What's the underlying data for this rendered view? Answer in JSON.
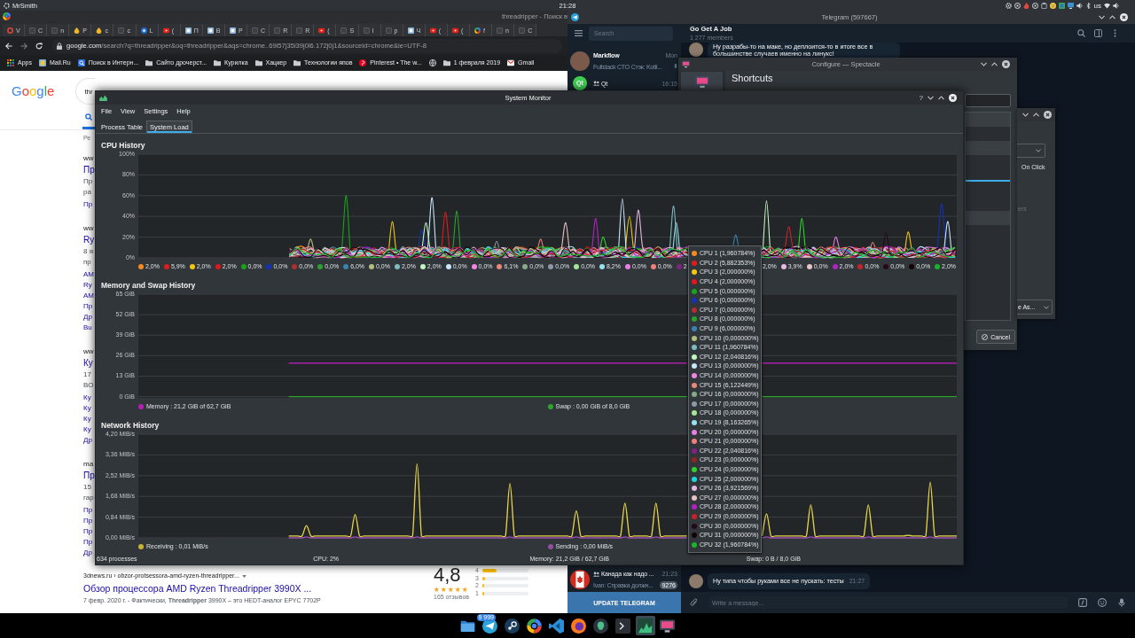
{
  "top_panel": {
    "user": "MrSmith",
    "clock": "21:28",
    "tray": [
      {
        "kind": "gear"
      },
      {
        "kind": "ring"
      },
      {
        "kind": "flame"
      },
      {
        "kind": "ring"
      },
      {
        "kind": "clipboard"
      },
      {
        "kind": "smiley"
      },
      {
        "kind": "tile"
      },
      {
        "kind": "screen"
      },
      {
        "kind": "speaker"
      },
      {
        "kind": "bluetooth"
      },
      {
        "kind": "text",
        "label": "us"
      },
      {
        "kind": "wifi"
      },
      {
        "kind": "speaker"
      }
    ]
  },
  "browser": {
    "title": "threadripper - Поиск в",
    "tabs": [
      {
        "kind": "ring",
        "label": "V"
      },
      {
        "kind": "page",
        "label": "C"
      },
      {
        "kind": "page",
        "label": "n"
      },
      {
        "kind": "drop",
        "label": "P"
      },
      {
        "kind": "drop",
        "label": "c"
      },
      {
        "kind": "page",
        "label": "c"
      },
      {
        "kind": "circle",
        "label": "L"
      },
      {
        "kind": "play",
        "label": "("
      },
      {
        "kind": "square",
        "label": "П"
      },
      {
        "kind": "square",
        "label": "В"
      },
      {
        "kind": "square",
        "label": "Р"
      },
      {
        "kind": "page",
        "label": "C"
      },
      {
        "kind": "page",
        "label": "R"
      },
      {
        "kind": "page",
        "label": "R"
      },
      {
        "kind": "play",
        "label": "("
      },
      {
        "kind": "page",
        "label": "S"
      },
      {
        "kind": "page",
        "label": "I"
      },
      {
        "kind": "page",
        "label": "p"
      },
      {
        "kind": "square",
        "label": "Ч"
      },
      {
        "kind": "play",
        "label": "("
      },
      {
        "kind": "play",
        "label": "("
      },
      {
        "kind": "google",
        "label": "f"
      },
      {
        "kind": "page",
        "label": "n"
      },
      {
        "kind": "page",
        "label": "C"
      }
    ],
    "address": {
      "host": "google.com",
      "path": "/search?q=threadripper&oq=threadripper&aqs=chrome..69i57j35i39j0l6.172j0j1&sourceid=chrome&ie=UTF-8"
    },
    "bookmarks": [
      {
        "kind": "grid",
        "label": "Apps"
      },
      {
        "kind": "square",
        "label": "Mail.Ru"
      },
      {
        "kind": "magnifier",
        "label": "Поиск в Интерн..."
      },
      {
        "kind": "folder",
        "label": "Сайто дрочерст..."
      },
      {
        "kind": "folder",
        "label": "Курилка"
      },
      {
        "kind": "folder",
        "label": "Хацкер"
      },
      {
        "kind": "folder",
        "label": "Технологии япов"
      },
      {
        "kind": "circle",
        "label": "Pinterest • The w..."
      },
      {
        "kind": "globe"
      },
      {
        "kind": "folder",
        "label": "1 февраля 2019"
      },
      {
        "kind": "envelope",
        "label": "Gmail"
      }
    ],
    "page": {
      "logo": "Google",
      "query": "thr",
      "result_count": "Ре",
      "results": [
        {
          "crumb": "ww",
          "title": "Пр",
          "snippet": [
            "Пр",
            "ра"
          ],
          "links": [
            "Пр"
          ]
        },
        {
          "crumb": "ww",
          "title": "Ry",
          "snippet": [
            "8 я",
            "пр"
          ],
          "links": [
            "AM",
            "Ry",
            "AM",
            "Пр",
            "Др",
            "Bu"
          ]
        },
        {
          "crumb": "ww",
          "title": "Ку",
          "snippet": [
            "17",
            "BO"
          ],
          "links": [
            "Ку",
            "Ку",
            "Ку",
            "Ку",
            "Др"
          ]
        },
        {
          "crumb": "ma",
          "title": "Пр",
          "snippet": [
            "15",
            "гар"
          ],
          "links": [
            "Пр",
            "Пр",
            "Пр",
            "Пр",
            "Др"
          ]
        }
      ],
      "featured": {
        "url": "3dnews.ru › obzor-protsessora-amd-ryzen-threadripper...",
        "title": "Обзор процессора AMD Ryzen Threadripper 3990X ...",
        "snippet": "7 февр. 2020 г. - Фактически, **Threadripper** 3990X – это HEDT-аналог EPYC 7702P"
      },
      "rating": {
        "score": "4,8",
        "stars": 5,
        "reviews": "165 отзывов",
        "bars": [
          {
            "label": "4",
            "level": 0.3
          },
          {
            "label": "3",
            "level": 0.06
          },
          {
            "label": "2",
            "level": 0.03
          },
          {
            "label": "1",
            "level": 0.04
          }
        ]
      }
    }
  },
  "telegram": {
    "title": "Telegram (597667)",
    "search": {
      "placeholder": "Search"
    },
    "chats_top": [
      {
        "kind": "photo",
        "name": "Markflow",
        "time": "Mon",
        "preview": "Fullstack CTO Стэк: Kotli...",
        "pinned": true,
        "group": false
      },
      {
        "kind": "logo",
        "avatar_text": "Qt",
        "name": "Qt",
        "time": "16:15",
        "pinned": false,
        "group": true
      }
    ],
    "chats_bottom": [
      {
        "kind": "flag",
        "name": "Канада как надо ...",
        "time": "21:23",
        "preview": "Ivan: Справка должн...",
        "badge": "9276",
        "pinned": false,
        "group": true
      }
    ],
    "update_button": "UPDATE TELEGRAM",
    "chat": {
      "title": "Go Get A Job",
      "subtitle": "1 277 members",
      "messages_top": [
        {
          "text": "Ну разрабы-то на маке, но деплоится-то в итоге все в большинстве случаев именно на линукс!"
        }
      ],
      "messages_bottom": [
        {
          "text": "Ну типа чтобы руками все не пускать: тесты",
          "time": "21:27"
        }
      ],
      "composer": {
        "placeholder": "Write a message..."
      }
    }
  },
  "spectacle": {
    "title": "Configure — Spectacle",
    "heading": "Shortcuts",
    "cancel": "Cancel"
  },
  "settings_dialog": {
    "options": [
      {
        "label": "On Click",
        "disabled": false
      },
      {
        "label": "ers",
        "disabled": true
      }
    ],
    "dropdown": "e As..."
  },
  "system_monitor": {
    "title": "System Monitor",
    "help": "?",
    "menu": [
      "File",
      "View",
      "Settings",
      "Help"
    ],
    "tabs": [
      {
        "label": "Process Table",
        "selected": false
      },
      {
        "label": "System Load",
        "selected": true
      }
    ],
    "sections": [
      {
        "kind": "per_core",
        "title": "CPU History",
        "y_labels": [
          "100%",
          "80%",
          "60%",
          "40%",
          "20%",
          "0%"
        ],
        "legend": {
          "start": [
            {
              "color": "#f58a1f",
              "reading": "2,0%"
            },
            {
              "color": "#e31a1c",
              "reading": "5,9%"
            },
            {
              "color": "#f2c713",
              "reading": "2,0%"
            },
            {
              "color": "#e4151b",
              "reading": "2,0%"
            },
            {
              "color": "#1aa31a",
              "reading": "0,0%"
            },
            {
              "color": "#1432b8",
              "reading": "0,0%"
            },
            {
              "color": "#b22d2d",
              "reading": "0,0%"
            },
            {
              "color": "#2ca02c",
              "reading": "0,0%"
            },
            {
              "color": "#3a84b0",
              "reading": "6,0%"
            },
            {
              "color": "#b5bd7d",
              "reading": "0,0%"
            },
            {
              "color": "#7cbcc0",
              "reading": "2,0%"
            },
            {
              "color": "#c3f5c0",
              "reading": "2,0%"
            },
            {
              "color": "#c6e8fb",
              "reading": "0,0%"
            },
            {
              "color": "#f384e0",
              "reading": "0,0%"
            },
            {
              "color": "#e8877a",
              "reading": "6,1%"
            },
            {
              "color": "#8aa88a",
              "reading": "0,0%"
            },
            {
              "color": "#8c98a4",
              "reading": "0,0%"
            },
            {
              "color": "#a6e597",
              "reading": "0,0%"
            },
            {
              "color": "#98e2ef",
              "reading": "8,2%"
            },
            {
              "color": "#e87ee6",
              "reading": "0,0%"
            },
            {
              "color": "#ef7f79",
              "reading": "0,0%"
            },
            {
              "color": "#7f2386",
              "reading": "2"
            }
          ],
          "end": [
            {
              "reading": "2,0%"
            },
            {
              "color": "#e6b8e4",
              "reading": "3,9%"
            },
            {
              "color": "#e6c3c5",
              "reading": "0,0%"
            },
            {
              "color": "#b025c0",
              "reading": "2,0%"
            },
            {
              "color": "#c8222a",
              "reading": "0,0%"
            },
            {
              "color": "#25081e",
              "reading": "0,0%"
            },
            {
              "color": "#120404",
              "reading": "0,0%"
            },
            {
              "color": "#18b52a",
              "reading": "2,0%"
            }
          ]
        }
      },
      {
        "kind": "pair",
        "title": "Memory and Swap History",
        "chart_data": {
          "type": "line",
          "grid": true,
          "categories": [
            null,
            null,
            null,
            null,
            null,
            null,
            null,
            null,
            null,
            null,
            null,
            null,
            null,
            null,
            null,
            null,
            null,
            null,
            null,
            null,
            null,
            null,
            null,
            null,
            null,
            null,
            null,
            null,
            null,
            null,
            null,
            null,
            null,
            null,
            null,
            null,
            null,
            null,
            null,
            null,
            null,
            null,
            null,
            null,
            null,
            null,
            null,
            null,
            null,
            null,
            null,
            null,
            null,
            null,
            null,
            null,
            null,
            null,
            null,
            null,
            null,
            null,
            null,
            null,
            null,
            null,
            null,
            null,
            null,
            null,
            null,
            null,
            null,
            null,
            null,
            null,
            null,
            null,
            null,
            null,
            null,
            null,
            null,
            null,
            null,
            null,
            null,
            null,
            null,
            null,
            null,
            null,
            null,
            null,
            null,
            null,
            null,
            null,
            null,
            null,
            null,
            null,
            null,
            null,
            null,
            null,
            null,
            null,
            null,
            null,
            null,
            null,
            null,
            null,
            null,
            null,
            null,
            null,
            null,
            null,
            null,
            null,
            null,
            null,
            null,
            null,
            null,
            null,
            null,
            null,
            null,
            null,
            null,
            null,
            null,
            null,
            null,
            null,
            null,
            null,
            null,
            null,
            null,
            null,
            null,
            null,
            null,
            null,
            null,
            null,
            null,
            null,
            null,
            null,
            null,
            null,
            null,
            null,
            null,
            null,
            null,
            null,
            null,
            null,
            null,
            null,
            null,
            null,
            null,
            null,
            null,
            null,
            null,
            null,
            null,
            null,
            null,
            null,
            null,
            null,
            null,
            null,
            null,
            null,
            null,
            null
          ],
          "ylim": [
            -0.8,
            65
          ],
          "yticks": [
            {
              "value": 0,
              "label": "0 GiB"
            },
            {
              "value": 13,
              "label": "13 GiB"
            },
            {
              "value": 26,
              "label": "26 GiB"
            },
            {
              "value": 39,
              "label": "39 GiB"
            },
            {
              "value": 52,
              "label": "52 GiB"
            },
            {
              "value": 65,
              "label": "65 GiB"
            }
          ],
          "series": [
            {
              "color": "#c41fc4",
              "values": [
                null,
                null,
                null,
                null,
                null,
                null,
                null,
                null,
                null,
                null,
                null,
                null,
                null,
                null,
                null,
                null,
                null,
                null,
                null,
                null,
                null,
                null,
                null,
                null,
                null,
                null,
                null,
                null,
                null,
                null,
                null,
                null,
                null,
                null,
                21.2,
                21.2,
                21.2,
                21.2,
                21.2,
                21.2,
                21.2,
                21.2,
                21.2,
                21.2,
                21.2,
                21.2,
                21.2,
                21.2,
                21.2,
                21.2,
                21.2,
                21.2,
                21.2,
                21.2,
                21.2,
                21.2,
                21.2,
                21.2,
                21.2,
                21.2,
                21.2,
                21.2,
                21.2,
                21.2,
                21.2,
                21.2,
                21.2,
                21.2,
                21.2,
                21.2,
                21.2,
                21.2,
                21.2,
                21.2,
                21.2,
                21.2,
                21.2,
                21.2,
                21.2,
                21.2,
                21.2,
                21.2,
                21.2,
                21.2,
                21.2,
                21.2,
                21.2,
                21.2,
                21.2,
                21.2,
                21.2,
                21.2,
                21.2,
                21.2,
                21.2,
                21.2,
                21.2,
                21.2,
                21.2,
                21.2,
                21.2,
                21.2,
                21.2,
                21.2,
                21.2,
                21.2,
                21.2,
                21.2,
                21.2,
                21.2,
                21.2,
                21.2,
                21.2,
                21.2,
                21.2,
                21.2,
                21.2,
                21.2,
                21.2,
                21.2,
                21.2,
                21.2,
                21.2,
                21.2,
                21.2,
                null,
                null,
                null,
                null,
                null,
                null,
                null,
                null,
                null,
                null,
                null,
                null,
                null,
                null,
                null,
                null,
                21.2,
                21.2,
                21.2,
                21.2,
                21.2,
                21.2,
                21.2,
                21.2,
                21.2,
                21.2,
                21.2,
                21.2,
                21.2,
                21.2,
                21.2,
                21.2,
                21.2,
                21.2,
                21.2,
                21.2,
                21.2,
                21.2,
                21.2,
                21.2,
                21.2,
                21.2,
                21.2,
                21.2,
                21.2,
                21.2,
                21.2,
                21.2,
                21.2,
                21.2,
                21.2,
                21.2,
                21.2,
                21.2,
                21.2,
                21.2,
                21.2,
                21.2,
                21.2,
                21.2,
                21.2
              ]
            },
            {
              "color": "#2ea62e",
              "values": [
                null,
                null,
                null,
                null,
                null,
                null,
                null,
                null,
                null,
                null,
                null,
                null,
                null,
                null,
                null,
                null,
                null,
                null,
                null,
                null,
                null,
                null,
                null,
                null,
                null,
                null,
                null,
                null,
                null,
                null,
                null,
                null,
                null,
                null,
                0,
                0,
                0,
                0,
                0,
                0,
                0,
                0,
                0,
                0,
                0,
                0,
                0,
                0,
                0,
                0,
                0,
                0,
                0,
                0,
                0,
                0,
                0,
                0,
                0,
                0,
                0,
                0,
                0,
                0,
                0,
                0,
                0,
                0,
                0,
                0,
                0,
                0,
                0,
                0,
                0,
                0,
                0,
                0,
                0,
                0,
                0,
                0,
                0,
                0,
                0,
                0,
                0,
                0,
                0,
                0,
                0,
                0,
                0,
                0,
                0,
                0,
                0,
                0,
                0,
                0,
                0,
                0,
                0,
                0,
                0,
                0,
                0,
                0,
                0,
                0,
                0,
                0,
                0,
                0,
                0,
                0,
                0,
                0,
                0,
                0,
                0,
                0,
                0,
                0,
                0,
                null,
                null,
                null,
                null,
                null,
                null,
                null,
                null,
                null,
                null,
                null,
                null,
                null,
                null,
                null,
                null,
                0,
                0,
                0,
                0,
                0,
                0,
                0,
                0,
                0,
                0,
                0,
                0,
                0,
                0,
                0,
                0,
                0,
                0,
                0,
                0,
                0,
                0,
                0,
                0,
                0,
                0,
                0,
                0,
                0,
                0,
                0,
                0,
                0,
                0,
                0,
                0,
                0,
                0,
                0,
                0,
                0,
                0,
                0,
                0,
                0
              ]
            }
          ]
        },
        "legend": [
          {
            "color": "#b41eb4",
            "reading": "Memory : 21,2 GiB of 62,7 GiB"
          },
          {
            "color": "#2ea62e",
            "reading": "Swap : 0,00 GiB of 8,0 GiB"
          }
        ]
      },
      {
        "kind": "pair",
        "title": "Network History",
        "chart_data": {
          "type": "line",
          "grid": true,
          "categories": [
            null,
            null,
            null,
            null,
            null,
            null,
            null,
            null,
            null,
            null,
            null,
            null,
            null,
            null,
            null,
            null,
            null,
            null,
            null,
            null,
            null,
            null,
            null,
            null,
            null,
            null,
            null,
            null,
            null,
            null,
            null,
            null,
            null,
            null,
            null,
            null,
            null,
            null,
            null,
            null,
            null,
            null,
            null,
            null,
            null,
            null,
            null,
            null,
            null,
            null,
            null,
            null,
            null,
            null,
            null,
            null,
            null,
            null,
            null,
            null,
            null,
            null,
            null,
            null,
            null,
            null,
            null,
            null,
            null,
            null,
            null,
            null,
            null,
            null,
            null,
            null,
            null,
            null,
            null,
            null,
            null,
            null,
            null,
            null,
            null,
            null,
            null,
            null,
            null,
            null,
            null,
            null,
            null,
            null,
            null,
            null,
            null,
            null,
            null,
            null,
            null,
            null,
            null,
            null,
            null,
            null,
            null,
            null,
            null,
            null,
            null,
            null,
            null,
            null,
            null,
            null,
            null,
            null,
            null,
            null,
            null,
            null,
            null,
            null,
            null,
            null,
            null,
            null,
            null,
            null,
            null,
            null,
            null,
            null,
            null,
            null,
            null,
            null,
            null,
            null,
            null,
            null,
            null,
            null,
            null,
            null,
            null,
            null,
            null,
            null,
            null,
            null,
            null,
            null,
            null,
            null,
            null,
            null,
            null,
            null,
            null,
            null,
            null,
            null,
            null,
            null,
            null,
            null,
            null,
            null,
            null,
            null,
            null,
            null,
            null,
            null,
            null,
            null,
            null,
            null,
            null,
            null,
            null,
            null,
            null,
            null
          ],
          "ylim": [
            0,
            4.2
          ],
          "yticks": [
            {
              "value": 0,
              "label": "0,00 MiB/s"
            },
            {
              "value": 0.84,
              "label": "0,84 MiB/s"
            },
            {
              "value": 1.68,
              "label": "1,68 MiB/s"
            },
            {
              "value": 2.52,
              "label": "2,52 MiB/s"
            },
            {
              "value": 3.36,
              "label": "3,36 MiB/s"
            },
            {
              "value": 4.2,
              "label": "4,20 MiB/s"
            }
          ],
          "series": [
            {
              "color": "#e8d64a",
              "values": [
                null,
                null,
                null,
                null,
                null,
                null,
                null,
                null,
                null,
                null,
                null,
                null,
                null,
                null,
                null,
                null,
                null,
                null,
                null,
                null,
                null,
                null,
                null,
                null,
                null,
                null,
                null,
                null,
                null,
                null,
                null,
                null,
                null,
                null,
                0.08,
                0.08,
                0.08,
                0.08,
                0.5,
                0.08,
                0.08,
                0.08,
                0.08,
                0.08,
                0.08,
                0.08,
                0.08,
                0.08,
                0.08,
                0.95,
                0.08,
                0.08,
                0.08,
                0.08,
                0.08,
                0.08,
                0.08,
                0.08,
                0.08,
                0.08,
                0.08,
                0.08,
                0.08,
                3.0,
                0.08,
                0.08,
                0.08,
                0.08,
                0.08,
                0.08,
                0.08,
                0.08,
                0.08,
                0.08,
                0.08,
                0.08,
                0.08,
                0.08,
                0.08,
                0.08,
                0.08,
                0.08,
                0.08,
                0.08,
                2.2,
                0.08,
                0.08,
                0.08,
                0.08,
                0.08,
                0.08,
                0.08,
                0.08,
                0.08,
                0.08,
                0.08,
                0.08,
                0.08,
                0.08,
                1.1,
                0.08,
                0.08,
                0.08,
                0.08,
                0.08,
                0.08,
                0.08,
                0.08,
                0.08,
                0.08,
                1.4,
                0.08,
                0.08,
                0.08,
                0.08,
                0.08,
                0.08,
                1.4,
                0.08,
                0.08,
                0.08,
                0.08,
                0.08,
                0.08,
                0.08,
                null,
                null,
                null,
                null,
                null,
                null,
                null,
                null,
                null,
                null,
                null,
                null,
                null,
                null,
                null,
                null,
                0.08,
                0.97,
                0.08,
                0.08,
                0.08,
                0.08,
                0.08,
                0.08,
                0.08,
                0.08,
                0.08,
                1.33,
                0.08,
                0.08,
                0.08,
                0.08,
                0.08,
                0.08,
                0.08,
                0.08,
                0.08,
                0.08,
                0.08,
                0.08,
                1.33,
                0.08,
                0.08,
                0.08,
                0.08,
                0.08,
                0.08,
                0.08,
                0.08,
                0.1,
                0.08,
                0.08,
                0.08,
                0.08,
                2.26,
                0.08,
                0.08,
                0.08,
                0.08,
                0.08,
                0.08
              ]
            },
            {
              "color": "#9b4fb0",
              "values": [
                null,
                null,
                null,
                null,
                null,
                null,
                null,
                null,
                null,
                null,
                null,
                null,
                null,
                null,
                null,
                null,
                null,
                null,
                null,
                null,
                null,
                null,
                null,
                null,
                null,
                null,
                null,
                null,
                null,
                null,
                null,
                null,
                null,
                null,
                0,
                0,
                0,
                0,
                0.04,
                0,
                0,
                0,
                0,
                0,
                0,
                0,
                0,
                0,
                0,
                0.04,
                0,
                0,
                0,
                0,
                0,
                0,
                0,
                0,
                0,
                0,
                0,
                0,
                0,
                0.04,
                0,
                0,
                0,
                0,
                0,
                0,
                0,
                0,
                0,
                0,
                0,
                0,
                0,
                0,
                0,
                0,
                0,
                0,
                0,
                0,
                0.04,
                0,
                0,
                0,
                0,
                0,
                0,
                0,
                0,
                0,
                0,
                0,
                0,
                0,
                0,
                0.04,
                0,
                0,
                0,
                0,
                0,
                0,
                0,
                0,
                0,
                0,
                0.04,
                0,
                0,
                0,
                0,
                0,
                0,
                0.04,
                0,
                0,
                0,
                0,
                0,
                0,
                0,
                null,
                null,
                null,
                null,
                null,
                null,
                null,
                null,
                null,
                null,
                null,
                null,
                null,
                null,
                null,
                null,
                0,
                0.04,
                0,
                0,
                0,
                0,
                0,
                0,
                0,
                0,
                0,
                0.04,
                0,
                0,
                0,
                0,
                0,
                0,
                0,
                0,
                0,
                0,
                0,
                0,
                0.04,
                0,
                0,
                0,
                0,
                0,
                0,
                0,
                0,
                0,
                0,
                0,
                0,
                0,
                0.04,
                0,
                0,
                0,
                0,
                0,
                0
              ]
            }
          ]
        },
        "legend": [
          {
            "color": "#c8b432",
            "reading": "Receiving : 0,01 MiB/s"
          },
          {
            "color": "#8e4fa0",
            "reading": "Sending : 0,00 MiB/s"
          }
        ]
      }
    ],
    "status_bar": [
      "634 processes",
      "CPU: 2%",
      "Memory: 21,2 GiB / 62,7 GiB",
      "Swap: 0 B / 8,0 GiB"
    ],
    "tooltip": [
      {
        "color": "#f58a1f",
        "text": "CPU 1 (1,960784%)"
      },
      {
        "color": "#e31a1c",
        "text": "CPU 2 (5,882353%)"
      },
      {
        "color": "#f2c713",
        "text": "CPU 3 (2,000000%)"
      },
      {
        "color": "#e4151b",
        "text": "CPU 4 (2,000000%)"
      },
      {
        "color": "#1aa31a",
        "text": "CPU 5 (0,000000%)"
      },
      {
        "color": "#1432b8",
        "text": "CPU 6 (0,000000%)"
      },
      {
        "color": "#b22d2d",
        "text": "CPU 7 (0,000000%)"
      },
      {
        "color": "#2ca02c",
        "text": "CPU 8 (0,000000%)"
      },
      {
        "color": "#3a84b0",
        "text": "CPU 9 (6,000000%)"
      },
      {
        "color": "#b5bd7d",
        "text": "CPU 10 (0,000000%)"
      },
      {
        "color": "#7cbcc0",
        "text": "CPU 11 (1,960784%)"
      },
      {
        "color": "#c3f5c0",
        "text": "CPU 12 (2,040816%)"
      },
      {
        "color": "#c6e8fb",
        "text": "CPU 13 (0,000000%)"
      },
      {
        "color": "#f384e0",
        "text": "CPU 14 (0,000000%)"
      },
      {
        "color": "#e8877a",
        "text": "CPU 15 (6,122449%)"
      },
      {
        "color": "#8aa88a",
        "text": "CPU 16 (0,000000%)"
      },
      {
        "color": "#8c98a4",
        "text": "CPU 17 (0,000000%)"
      },
      {
        "color": "#a6e597",
        "text": "CPU 18 (0,000000%)"
      },
      {
        "color": "#98e2ef",
        "text": "CPU 19 (8,163265%)"
      },
      {
        "color": "#e87ee6",
        "text": "CPU 20 (0,000000%)"
      },
      {
        "color": "#ef7f79",
        "text": "CPU 21 (0,000000%)"
      },
      {
        "color": "#7f2386",
        "text": "CPU 22 (2,040816%)"
      },
      {
        "color": "#8f2525",
        "text": "CPU 23 (0,000000%)"
      },
      {
        "color": "#2fd32f",
        "text": "CPU 24 (0,000000%)"
      },
      {
        "color": "#1fd6e0",
        "text": "CPU 25 (2,000000%)"
      },
      {
        "color": "#e6b8e4",
        "text": "CPU 26 (3,921569%)"
      },
      {
        "color": "#e6c3c5",
        "text": "CPU 27 (0,000000%)"
      },
      {
        "color": "#b025c0",
        "text": "CPU 28 (2,000000%)"
      },
      {
        "color": "#c8222a",
        "text": "CPU 29 (0,000000%)"
      },
      {
        "color": "#25081e",
        "text": "CPU 30 (0,000000%)"
      },
      {
        "color": "#120404",
        "text": "CPU 31 (0,000000%)"
      },
      {
        "color": "#18b52a",
        "text": "CPU 32 (1,960784%)"
      }
    ]
  },
  "taskbar": {
    "items": [
      {
        "kind": "folder",
        "selected": false
      },
      {
        "kind": "plane",
        "badge": "9 999",
        "selected": false
      },
      {
        "kind": "disc",
        "selected": false
      },
      {
        "kind": "chrome",
        "selected": false
      },
      {
        "kind": "ribbon",
        "selected": false
      },
      {
        "kind": "fox",
        "selected": false
      },
      {
        "kind": "emblem",
        "selected": false
      },
      {
        "kind": "terminal",
        "selected": false
      },
      {
        "kind": "chart",
        "selected": true
      },
      {
        "kind": "screen",
        "selected": false
      }
    ]
  }
}
